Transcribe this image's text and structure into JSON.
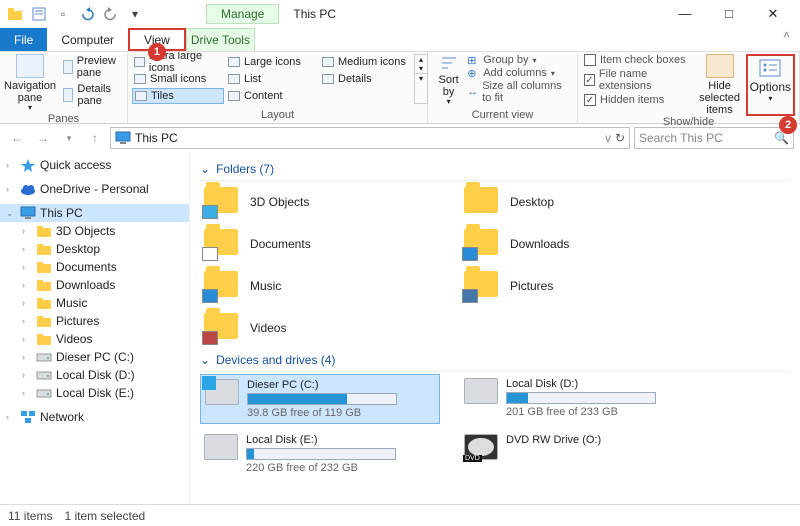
{
  "window": {
    "title_tab_manage": "Manage",
    "title_tab_loc": "This PC"
  },
  "winctl": {
    "min": "—",
    "max": "□",
    "close": "✕"
  },
  "qat": {
    "dropdown": "▾"
  },
  "tabs": {
    "file": "File",
    "computer": "Computer",
    "view": "View",
    "drive": "Drive Tools"
  },
  "callouts": {
    "one": "1",
    "two": "2"
  },
  "ribbon": {
    "panes": {
      "nav": "Navigation pane",
      "preview": "Preview pane",
      "details": "Details pane",
      "label": "Panes"
    },
    "layout": {
      "items": [
        "Extra large icons",
        "Large icons",
        "Medium icons",
        "Small icons",
        "List",
        "Details",
        "Tiles",
        "Content"
      ],
      "label": "Layout"
    },
    "sortby": "Sort by",
    "currentview": {
      "group": "Group by",
      "add": "Add columns",
      "size": "Size all columns to fit",
      "label": "Current view"
    },
    "showhide": {
      "checkboxes": "Item check boxes",
      "ext": "File name extensions",
      "hidden": "Hidden items",
      "hide": "Hide selected items",
      "label": "Show/hide"
    },
    "options": "Options"
  },
  "address": {
    "loc": "This PC",
    "refresh": "↻",
    "dropdown": "v"
  },
  "search": {
    "placeholder": "Search This PC"
  },
  "tree": {
    "items": [
      {
        "l": 0,
        "exp": "›",
        "label": "Quick access",
        "icon": "star"
      },
      {
        "l": 0,
        "exp": "›",
        "label": "OneDrive - Personal",
        "icon": "cloud"
      },
      {
        "l": 0,
        "exp": "⌄",
        "label": "This PC",
        "icon": "monitor",
        "sel": true
      },
      {
        "l": 1,
        "exp": "›",
        "label": "3D Objects",
        "icon": "folder"
      },
      {
        "l": 1,
        "exp": "›",
        "label": "Desktop",
        "icon": "folder"
      },
      {
        "l": 1,
        "exp": "›",
        "label": "Documents",
        "icon": "folder"
      },
      {
        "l": 1,
        "exp": "›",
        "label": "Downloads",
        "icon": "folder"
      },
      {
        "l": 1,
        "exp": "›",
        "label": "Music",
        "icon": "folder"
      },
      {
        "l": 1,
        "exp": "›",
        "label": "Pictures",
        "icon": "folder"
      },
      {
        "l": 1,
        "exp": "›",
        "label": "Videos",
        "icon": "folder"
      },
      {
        "l": 1,
        "exp": "›",
        "label": "Dieser PC (C:)",
        "icon": "drive"
      },
      {
        "l": 1,
        "exp": "›",
        "label": "Local Disk (D:)",
        "icon": "drive"
      },
      {
        "l": 1,
        "exp": "›",
        "label": "Local Disk (E:)",
        "icon": "drive"
      },
      {
        "l": 0,
        "exp": "›",
        "label": "Network",
        "icon": "network"
      }
    ]
  },
  "content": {
    "folders_hdr": "Folders (7)",
    "folders": [
      "3D Objects",
      "Desktop",
      "Documents",
      "Downloads",
      "Music",
      "Pictures",
      "Videos"
    ],
    "drives_hdr": "Devices and drives (4)",
    "drives": [
      {
        "name": "Dieser PC (C:)",
        "free": "39.8 GB free of 119 GB",
        "pct": 67,
        "sel": true,
        "type": "os"
      },
      {
        "name": "Local Disk (D:)",
        "free": "201 GB free of 233 GB",
        "pct": 14,
        "type": "hdd"
      },
      {
        "name": "Local Disk (E:)",
        "free": "220 GB free of 232 GB",
        "pct": 5,
        "type": "hdd"
      },
      {
        "name": "DVD RW Drive (O:)",
        "free": "",
        "pct": null,
        "type": "dvd"
      }
    ]
  },
  "status": {
    "items": "11 items",
    "selected": "1 item selected"
  }
}
